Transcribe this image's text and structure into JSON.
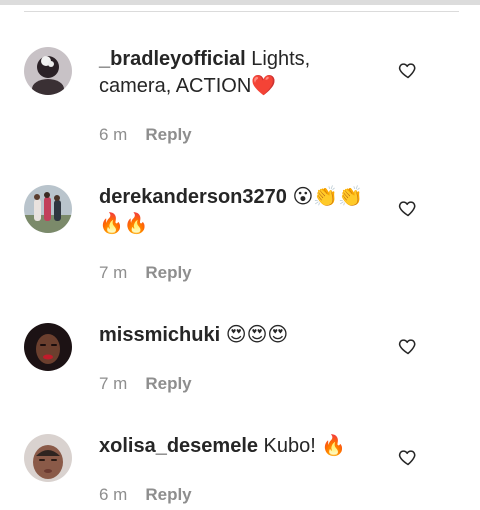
{
  "comments": [
    {
      "username": "_bradleyofficial",
      "text": " Lights, camera, ACTION❤️",
      "time": "6 m",
      "reply_label": "Reply",
      "avatar_icon": "avatar-photo-bradley",
      "like_icon": "heart-outline-icon"
    },
    {
      "username": "derekanderson3270",
      "text": " 😮👏👏🔥🔥",
      "time": "7 m",
      "reply_label": "Reply",
      "avatar_icon": "avatar-photo-group",
      "like_icon": "heart-outline-icon"
    },
    {
      "username": "missmichuki",
      "text": " 😍😍😍",
      "time": "7 m",
      "reply_label": "Reply",
      "avatar_icon": "avatar-photo-missmichuki",
      "like_icon": "heart-outline-icon"
    },
    {
      "username": "xolisa_desemele",
      "text": " Kubo! 🔥",
      "time": "6 m",
      "reply_label": "Reply",
      "avatar_icon": "avatar-photo-xolisa",
      "like_icon": "heart-outline-icon"
    }
  ],
  "colors": {
    "text": "#262626",
    "meta": "#8e8e8e",
    "divider": "#dbdbdb"
  }
}
